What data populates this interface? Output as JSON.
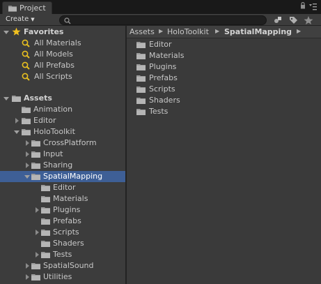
{
  "tab": {
    "title": "Project",
    "icon": "folder-icon"
  },
  "toolbar": {
    "create_label": "Create",
    "search_placeholder": "",
    "buttons": [
      "filter-by-type-icon",
      "filter-by-label-icon",
      "favorites-star-icon"
    ]
  },
  "colors": {
    "selection": "#3e5f96",
    "favorite_star": "#f0c020",
    "search_glass": "#e8c020",
    "folder": "#9c9c9c"
  },
  "tree": {
    "favorites": {
      "label": "Favorites",
      "items": [
        "All Materials",
        "All Models",
        "All Prefabs",
        "All Scripts"
      ]
    },
    "assets": {
      "label": "Assets",
      "animation": "Animation",
      "editor": "Editor",
      "holotoolkit": "HoloToolkit",
      "crossplatform": "CrossPlatform",
      "input": "Input",
      "sharing": "Sharing",
      "spatialmapping": "SpatialMapping",
      "sm_editor": "Editor",
      "sm_materials": "Materials",
      "sm_plugins": "Plugins",
      "sm_prefabs": "Prefabs",
      "sm_scripts": "Scripts",
      "sm_shaders": "Shaders",
      "sm_tests": "Tests",
      "spatialsound": "SpatialSound",
      "utilities": "Utilities"
    }
  },
  "breadcrumb": [
    "Assets",
    "HoloToolkit",
    "SpatialMapping"
  ],
  "contents": [
    "Editor",
    "Materials",
    "Plugins",
    "Prefabs",
    "Scripts",
    "Shaders",
    "Tests"
  ]
}
